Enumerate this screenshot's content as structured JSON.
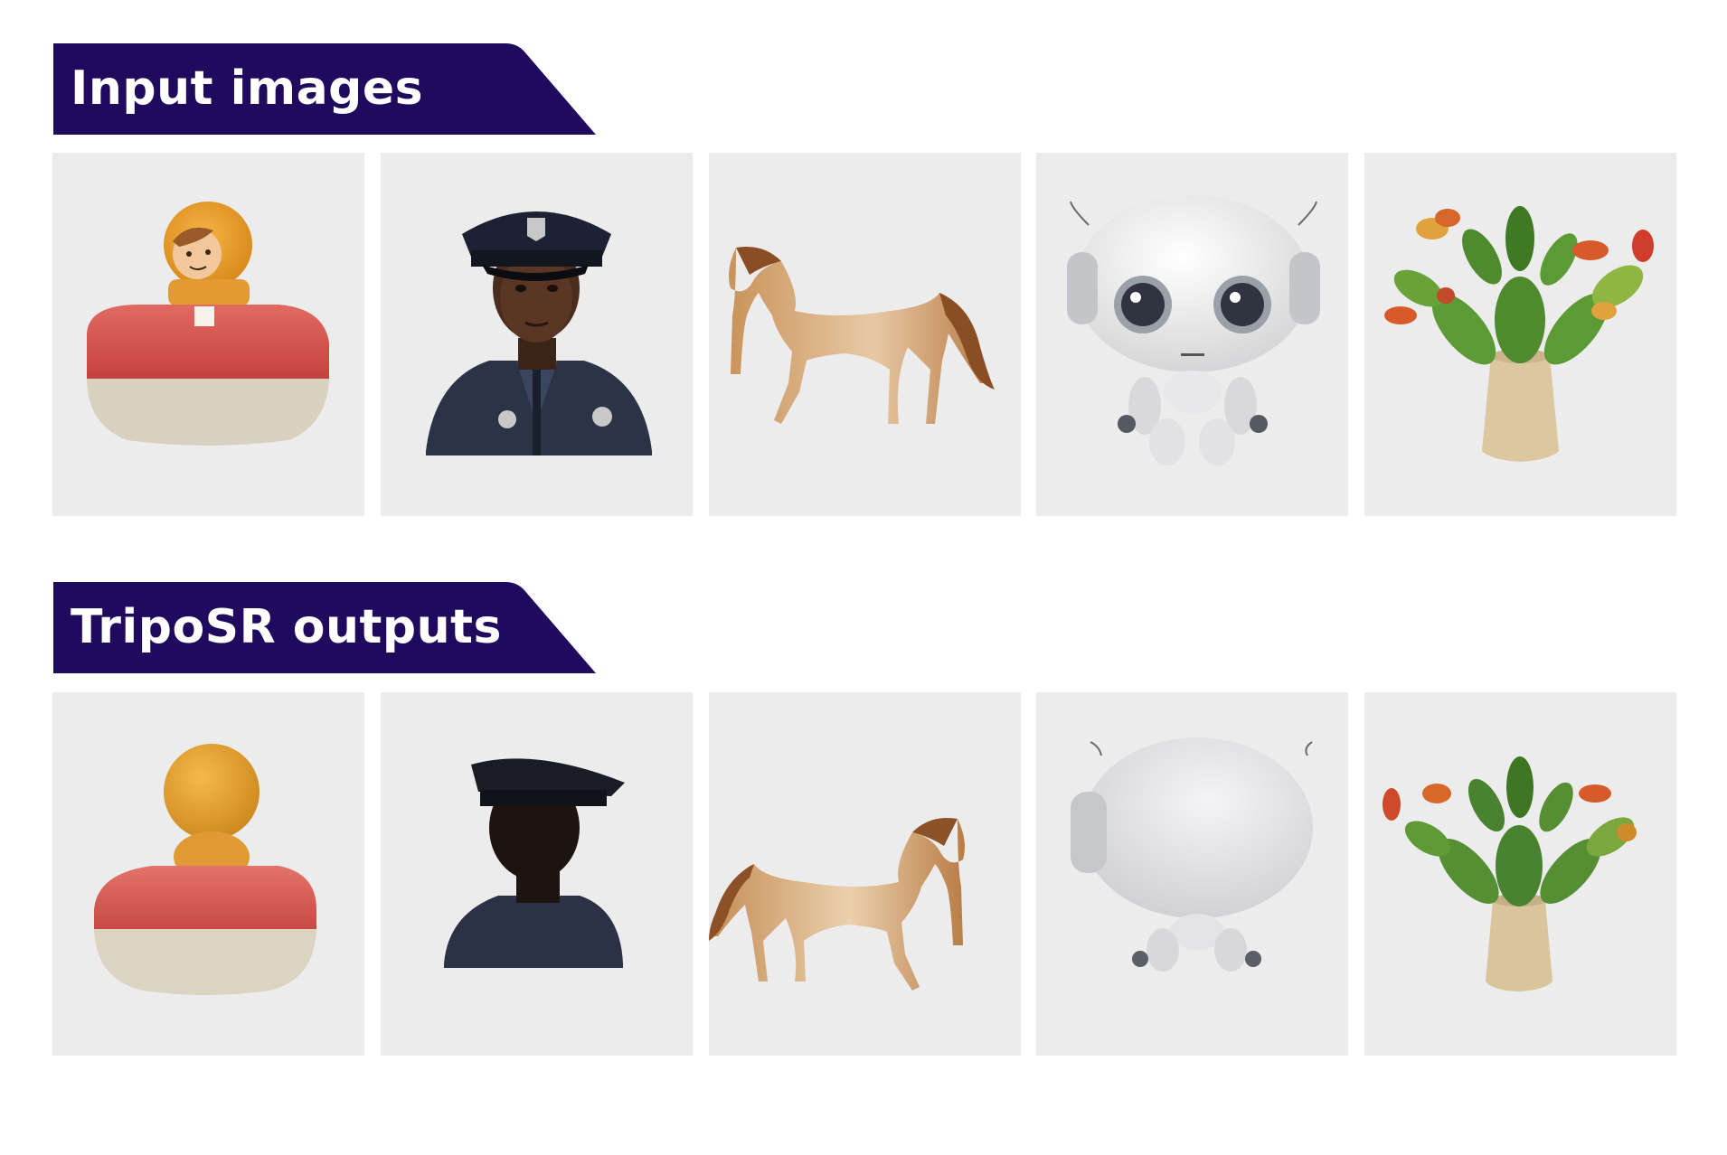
{
  "sections": {
    "input": {
      "title": "Input images"
    },
    "output": {
      "title": "TripoSR outputs"
    }
  },
  "colors": {
    "banner": "#1f0a5e",
    "tile_background": "#ececec",
    "label_text": "#ffffff"
  },
  "input_images": [
    {
      "name": "toy-figure-in-red-boat"
    },
    {
      "name": "police-officer"
    },
    {
      "name": "horse"
    },
    {
      "name": "white-robot"
    },
    {
      "name": "cactus-balancing-toy"
    }
  ],
  "output_renders": [
    {
      "name": "toy-figure-in-red-boat-3d"
    },
    {
      "name": "police-officer-3d"
    },
    {
      "name": "horse-3d"
    },
    {
      "name": "white-robot-3d"
    },
    {
      "name": "cactus-balancing-toy-3d"
    }
  ]
}
